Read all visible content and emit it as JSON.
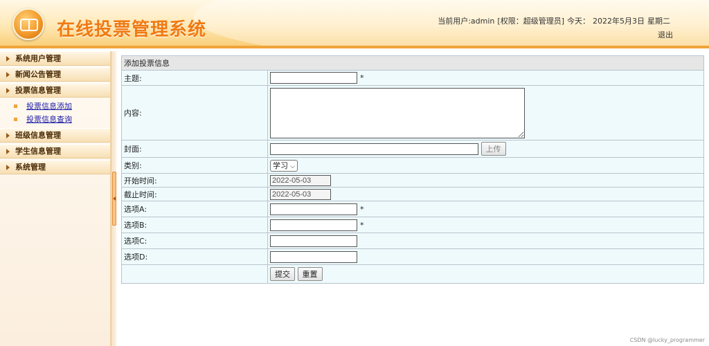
{
  "header": {
    "site_title": "在线投票管理系统",
    "user_label": "当前用户:admin",
    "role_label": "[权限：超级管理员]",
    "today_label": "今天：",
    "date": "2022年5月3日",
    "weekday": "星期二",
    "logout": "退出"
  },
  "sidebar": {
    "menus": [
      {
        "label": "系统用户管理"
      },
      {
        "label": "新闻公告管理"
      },
      {
        "label": "投票信息管理",
        "items": [
          "投票信息添加",
          "投票信息查询"
        ]
      },
      {
        "label": "班级信息管理"
      },
      {
        "label": "学生信息管理"
      },
      {
        "label": "系统管理"
      }
    ]
  },
  "form": {
    "title": "添加投票信息",
    "required_mark": "*",
    "subject_label": "主题:",
    "subject_value": "",
    "content_label": "内容:",
    "content_value": "",
    "cover_label": "封面:",
    "cover_value": "",
    "upload_button": "上传",
    "category_label": "类别:",
    "category_selected": "学习",
    "start_label": "开始时间:",
    "start_value": "2022-05-03",
    "end_label": "截止时间:",
    "end_value": "2022-05-03",
    "optA_label": "选项A:",
    "optA_value": "",
    "optB_label": "选项B:",
    "optB_value": "",
    "optC_label": "选项C:",
    "optC_value": "",
    "optD_label": "选项D:",
    "optD_value": "",
    "submit_button": "提交",
    "reset_button": "重置"
  },
  "footer": {
    "watermark": "CSDN @lucky_programmer"
  },
  "icons": {
    "menu_arrow": "triangle-right-icon",
    "submenu_bullet": "square-bullet-icon",
    "logo": "logo-icon",
    "select_chevron": "chevron-down-icon"
  },
  "colors": {
    "title_orange": "#f07a12",
    "header_band": "#f0a43a",
    "form_row_bg": "#eefafc",
    "link_blue": "#1a1aa6"
  }
}
